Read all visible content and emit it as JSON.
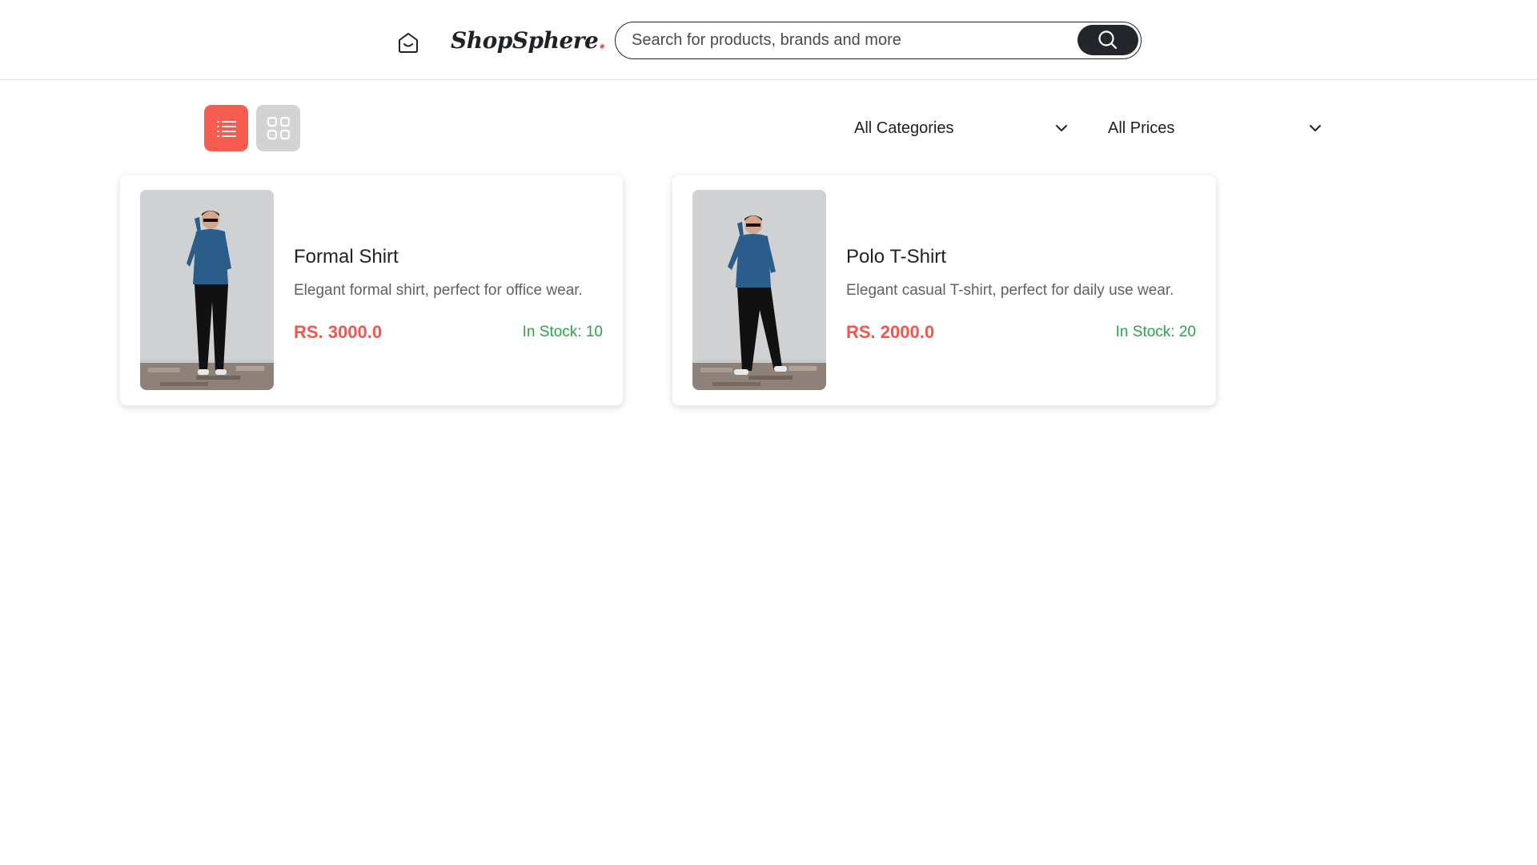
{
  "header": {
    "home_icon": "home-icon",
    "brand": "ShopSphere",
    "brand_dot": ".",
    "search": {
      "placeholder": "Search for products, brands and more",
      "value": "",
      "icon": "search-icon"
    }
  },
  "toolbar": {
    "views": [
      {
        "name": "list-view",
        "icon": "list-icon",
        "active": true,
        "color": "#f75c50"
      },
      {
        "name": "grid-view",
        "icon": "grid-icon",
        "active": false,
        "color": "#d3d3d3"
      }
    ],
    "category_select": {
      "value": "All Categories",
      "icon": "chevron-down-icon"
    },
    "price_select": {
      "value": "All Prices",
      "icon": "chevron-down-icon"
    }
  },
  "products": [
    {
      "name": "Formal Shirt",
      "description": "Elegant formal shirt, perfect for office wear.",
      "price": "RS. 3000.0",
      "stock": "In Stock: 10"
    },
    {
      "name": "Polo T-Shirt",
      "description": "Elegant casual T-shirt, perfect for daily use wear.",
      "price": "RS. 2000.0",
      "stock": "In Stock: 20"
    }
  ],
  "colors": {
    "accent": "#f2564c",
    "stock": "#2aa44a",
    "dark": "#23272b",
    "inactive": "#d3d3d3"
  }
}
